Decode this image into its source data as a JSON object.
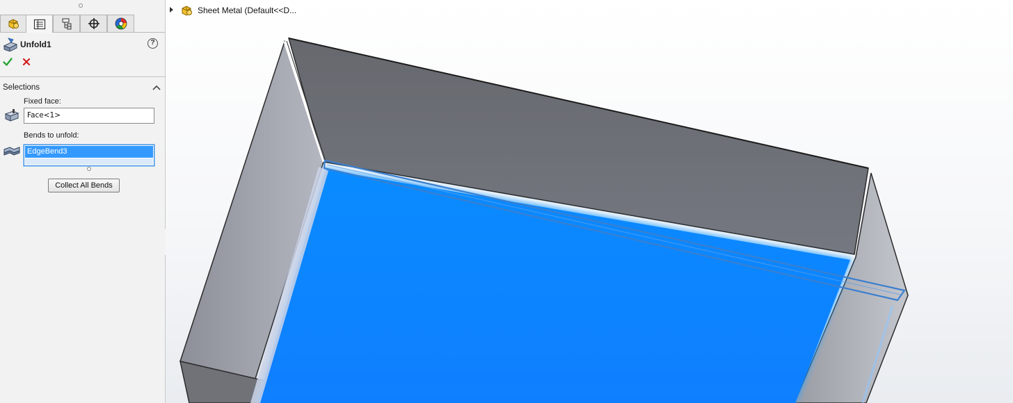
{
  "panel": {
    "tabs": [
      {
        "name": "feature-manager-tab",
        "icon": "part-icon"
      },
      {
        "name": "property-manager-tab",
        "icon": "property-list-icon",
        "active": true
      },
      {
        "name": "configuration-manager-tab",
        "icon": "configuration-icon"
      },
      {
        "name": "dimxpert-manager-tab",
        "icon": "crosshair-icon"
      },
      {
        "name": "display-manager-tab",
        "icon": "color-wheel-icon"
      }
    ],
    "title": "Unfold1",
    "help_symbol": "?",
    "selections_header": "Selections",
    "fixed_face_label": "Fixed face:",
    "fixed_face_value": "Face<1>",
    "bends_label": "Bends to unfold:",
    "bends_items": [
      "EdgeBend3"
    ],
    "collect_button": "Collect All Bends"
  },
  "tree": {
    "label": "Sheet Metal  (Default<<D..."
  },
  "colors": {
    "selected_face": "#0a86ff",
    "wall_dark": "#6f7279",
    "wall_light": "#a7a9b3",
    "accept": "#2aa53a",
    "cancel": "#d21f1f",
    "list_highlight": "#3399ff"
  }
}
